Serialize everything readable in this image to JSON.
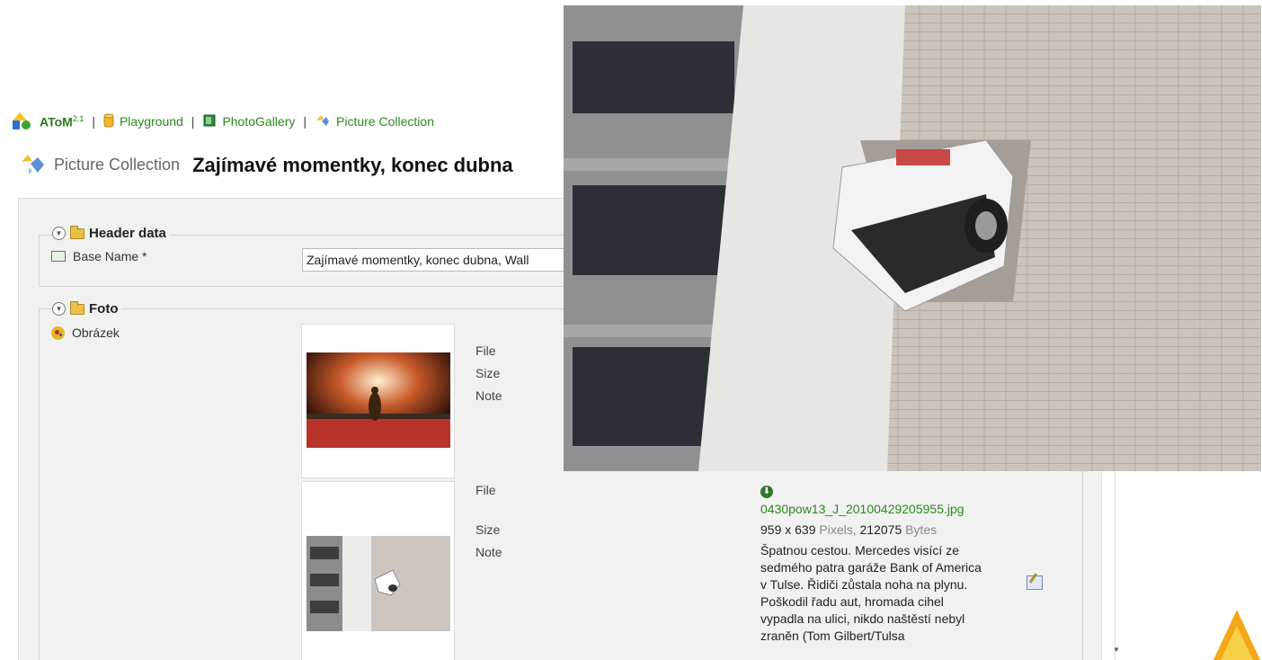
{
  "breadcrumb": {
    "app": "AToM",
    "app_version": "2.1",
    "items": [
      "Playground",
      "PhotoGallery",
      "Picture Collection"
    ],
    "separator": "|"
  },
  "title": {
    "kind": "Picture Collection",
    "name": "Zajímavé momentky, konec dubna"
  },
  "header_group": {
    "legend": "Header data",
    "base_name_label": "Base Name *",
    "base_name_value": "Zajímavé momentky, konec dubna, Wall"
  },
  "foto_group": {
    "legend": "Foto",
    "field_label": "Obrázek",
    "items": [
      {
        "file_label": "File",
        "size_label": "Size",
        "note_label": "Note"
      },
      {
        "file_label": "File",
        "size_label": "Size",
        "note_label": "Note",
        "file_name": "0430pow13_J_20100429205955.jpg",
        "width": "959",
        "x": "x",
        "height": "639",
        "pixels_unit": "Pixels,",
        "bytes": "212075",
        "bytes_unit": "Bytes",
        "note": "Špatnou cestou. Mercedes visící ze sedmého patra garáže Bank of America v Tulse. Řidiči zůstala noha na plynu. Poškodil řadu aut, hromada cihel vypadla na ulici, nikdo naštěstí nebyl zraněn (Tom Gilbert/Tulsa"
      }
    ]
  },
  "icons": {
    "atom_logo": "atom-logo-icon",
    "playground": "database-icon",
    "photogallery": "book-icon",
    "picture_collection": "picture-collection-icon",
    "collapse": "collapse-icon",
    "folder": "folder-icon",
    "base_name": "text-field-icon",
    "obrazek": "palette-icon",
    "download": "download-icon",
    "edit": "edit-icon"
  },
  "colors": {
    "link": "#2a8a1c",
    "panel": "#f1f1f1"
  }
}
